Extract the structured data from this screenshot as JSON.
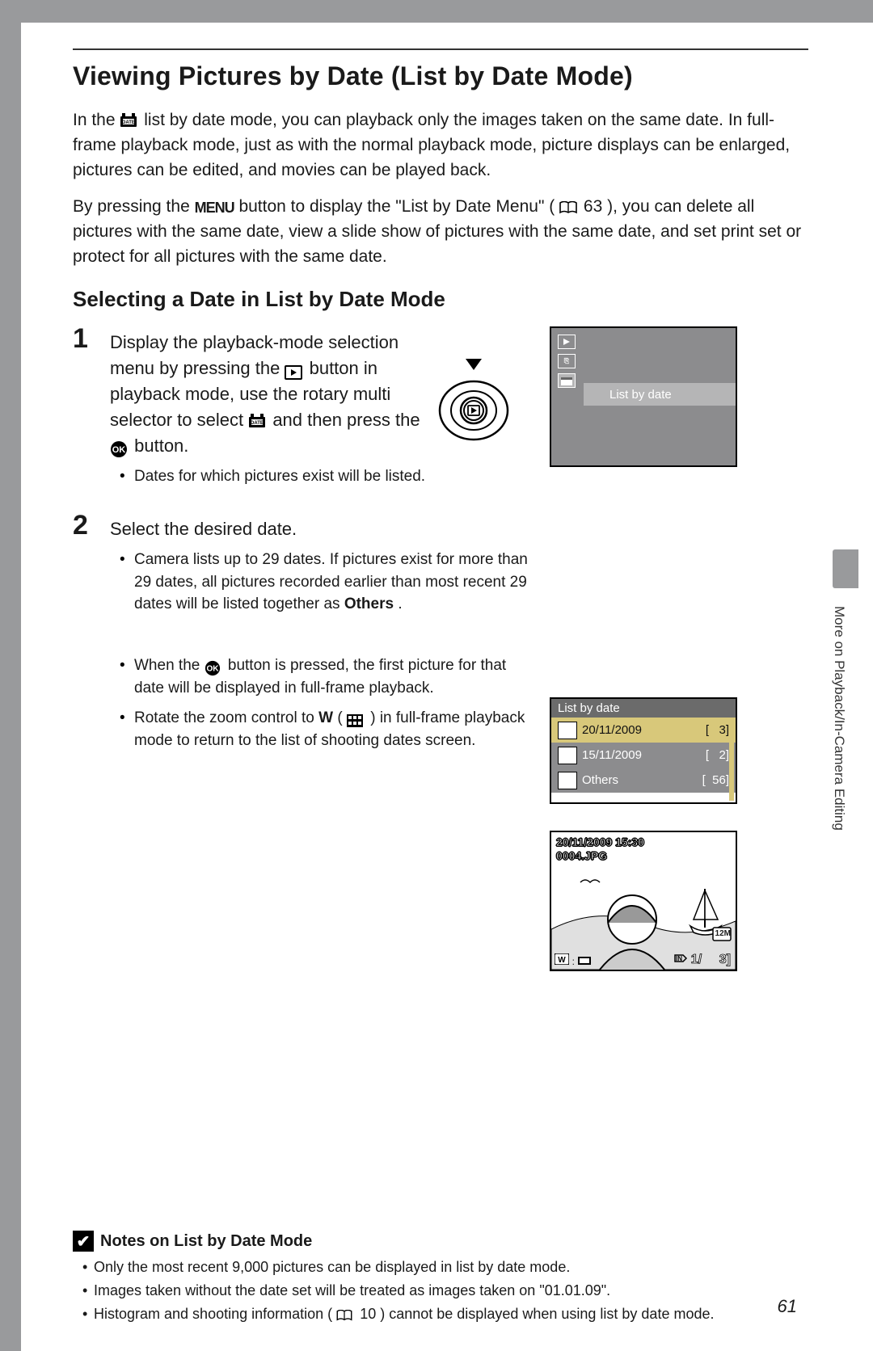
{
  "title": "Viewing Pictures by Date (List by Date Mode)",
  "intro1a": "In the ",
  "intro1b": " list by date mode, you can playback only the images taken on the same date. In full-frame playback mode, just as with the normal playback mode, picture displays can be enlarged, pictures can be edited, and movies can be played back.",
  "intro2a": "By pressing the ",
  "menu_label": "MENU",
  "intro2b": " button to display the \"List by Date Menu\" (",
  "intro2_ref": "63",
  "intro2c": "), you can delete all pictures with the same date, view a slide show of pictures with the same date, and set print set or protect for all pictures with the same date.",
  "subhead": "Selecting a Date in List by Date Mode",
  "step1_num": "1",
  "step1_a": "Display the playback-mode selection menu by pressing the ",
  "step1_b": " button in playback mode, use the rotary multi selector to select ",
  "step1_c": " and then press the ",
  "step1_d": " button.",
  "step1_bullet1": "Dates for which pictures exist will be listed.",
  "step2_num": "2",
  "step2_text": "Select the desired date.",
  "step2_b1a": "Camera lists up to 29 dates. If pictures exist for more than 29 dates, all pictures recorded earlier than most recent 29 dates will be listed together as ",
  "step2_b1_strong": "Others",
  "step2_b1b": ".",
  "step2_b2a": "When the ",
  "step2_b2b": " button is pressed, the first picture for that date will be displayed in full-frame playback.",
  "step2_b3a": "Rotate the zoom control to ",
  "step2_b3_w": "W",
  "step2_b3b": " (",
  "step2_b3c": ") in full-frame playback mode to return to the list of shooting dates screen.",
  "lcd": {
    "menu_label": "List by date"
  },
  "list": {
    "title": "List by date",
    "rows": [
      {
        "date": "20/11/2009",
        "count": "[   3]"
      },
      {
        "date": "15/11/2009",
        "count": "[   2]"
      },
      {
        "date": "Others",
        "count": "[  56]"
      }
    ]
  },
  "play": {
    "date": "20/11/2009 15:30",
    "file": "0004.JPG",
    "index": "1/",
    "total": "3]",
    "badge": "12M"
  },
  "side_tab": "More on Playback/In-Camera Editing",
  "notes_title": "Notes on List by Date Mode",
  "notes": {
    "n1": "Only the most recent 9,000 pictures can be displayed in list by date mode.",
    "n2": "Images taken without the date set will be treated as images taken on \"01.01.09\".",
    "n3a": "Histogram and shooting information (",
    "n3_ref": "10",
    "n3b": ") cannot be displayed when using list by date mode."
  },
  "page_number": "61"
}
